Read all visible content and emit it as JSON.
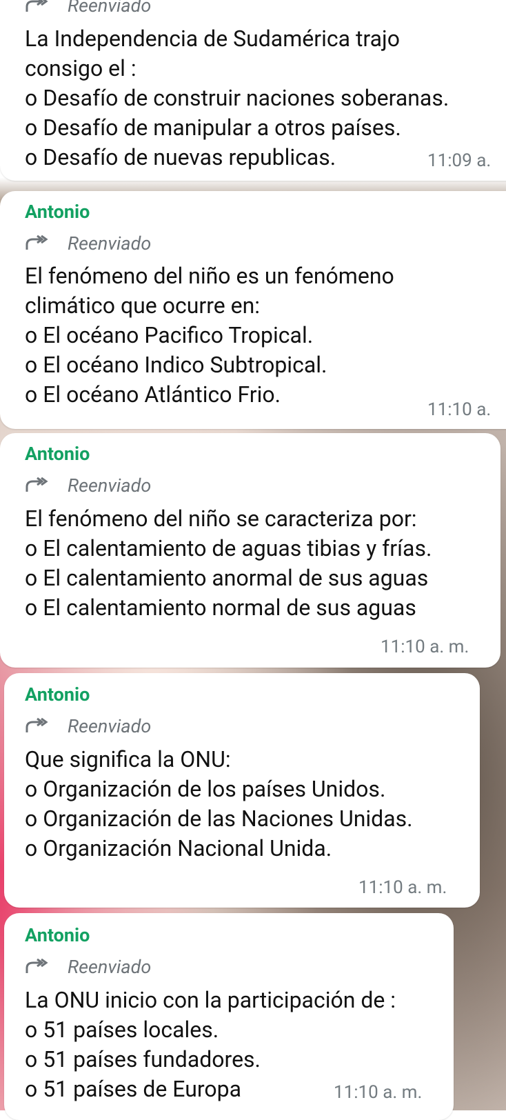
{
  "messages": [
    {
      "forwarded_label": "Reenviado",
      "lines": [
        "La Independencia de Sudamérica trajo",
        "consigo el :",
        "o  Desafío de construir naciones soberanas.",
        "o  Desafío de manipular a otros países.",
        "o  Desafío de nuevas republicas."
      ],
      "time": "11:09 a."
    },
    {
      "sender": "Antonio",
      "forwarded_label": "Reenviado",
      "lines": [
        "El fenómeno del niño es un fenómeno",
        "climático que ocurre en:",
        "o  El océano Pacifico Tropical.",
        "o  El océano Indico Subtropical.",
        "o   El océano Atlántico Frio."
      ],
      "time": "11:10 a."
    },
    {
      "sender": "Antonio",
      "forwarded_label": "Reenviado",
      "lines": [
        "El fenómeno del niño se caracteriza por:",
        "o  El calentamiento de aguas tibias y frías.",
        "o  El calentamiento anormal de sus aguas",
        "o  El calentamiento normal de sus aguas"
      ],
      "time": "11:10 a. m."
    },
    {
      "sender": "Antonio",
      "forwarded_label": "Reenviado",
      "lines": [
        "Que  significa la  ONU:",
        "o  Organización de los países Unidos.",
        "o  Organización de las Naciones Unidas.",
        "o  Organización Nacional Unida."
      ],
      "time": "11:10 a. m."
    },
    {
      "sender": "Antonio",
      "forwarded_label": "Reenviado",
      "lines": [
        "La ONU inicio con la participación de :",
        "o  51 países locales.",
        "o  51 países fundadores.",
        "o  51 países de Europa"
      ],
      "time": "11:10 a. m."
    }
  ],
  "icons": {
    "forwarded": "forwarded-arrow-icon"
  },
  "colors": {
    "sender_name": "#13a162",
    "meta_text": "#737b80",
    "bubble": "#ffffff"
  }
}
